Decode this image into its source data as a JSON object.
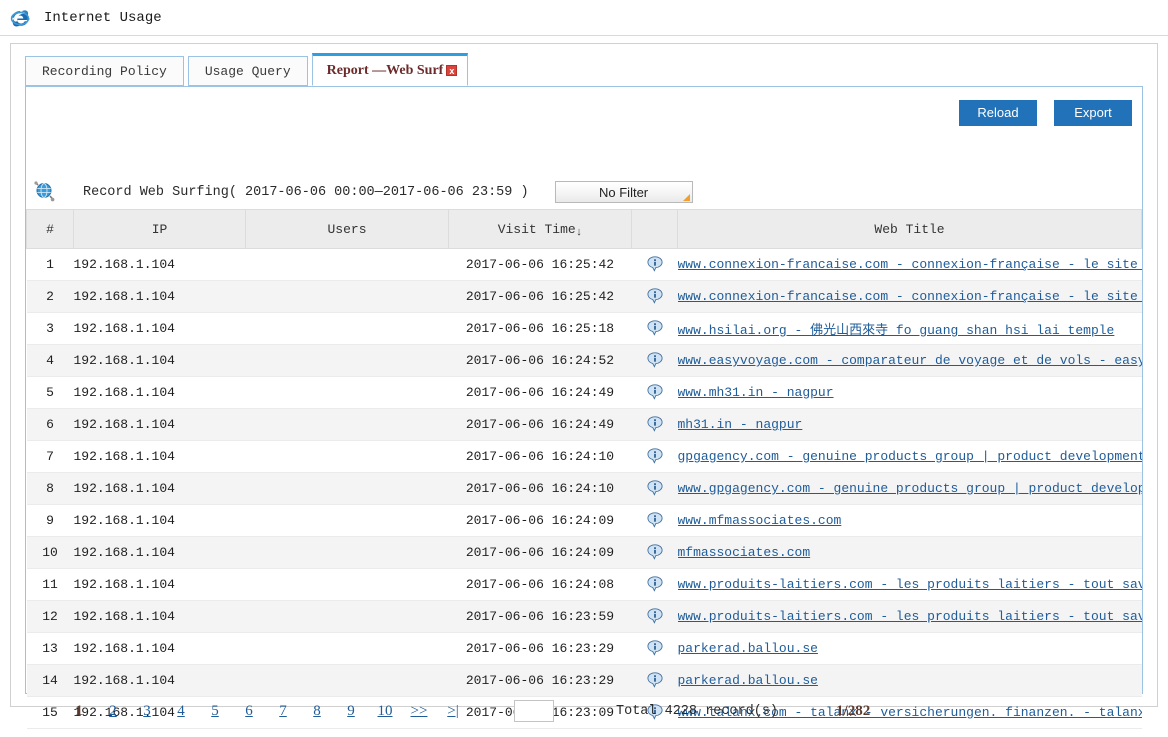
{
  "window": {
    "title": "Internet Usage",
    "browser_icon": "internet-explorer-icon"
  },
  "tabs": [
    {
      "label": "Recording Policy",
      "active": false
    },
    {
      "label": "Usage Query",
      "active": false
    },
    {
      "label": "Report —Web Surf",
      "active": true,
      "close_label": "x"
    }
  ],
  "toolbar": {
    "reload_label": "Reload",
    "export_label": "Export"
  },
  "record_header": {
    "icon": "globe-icon",
    "label": "Record Web Surfing( 2017-06-06 00:00—2017-06-06 23:59 )",
    "filter_value": "No Filter"
  },
  "table": {
    "columns": [
      "#",
      "IP",
      "Users",
      "Visit Time",
      "",
      "Web Title"
    ],
    "sort_column": "Visit Time",
    "sort_direction": "desc",
    "sort_arrow": "↓",
    "info_icon": "info-bubble-icon",
    "rows": [
      {
        "num": "1",
        "ip": "192.168.1.104",
        "user": "",
        "time": "2017-06-06 16:25:42",
        "title": "www.connexion-francaise.com  -   connexion-française - le site pra",
        "truncated": true
      },
      {
        "num": "2",
        "ip": "192.168.1.104",
        "user": "",
        "time": "2017-06-06 16:25:42",
        "title": "www.connexion-francaise.com  -   connexion-française - le site pra",
        "truncated": true
      },
      {
        "num": "3",
        "ip": "192.168.1.104",
        "user": "",
        "time": "2017-06-06 16:25:18",
        "title": "www.hsilai.org  -   佛光山西來寺 fo guang shan hsi lai temple",
        "truncated": false
      },
      {
        "num": "4",
        "ip": "192.168.1.104",
        "user": "",
        "time": "2017-06-06 16:24:52",
        "title": "www.easyvoyage.com  -   comparateur de voyage et de vols - easyvoy",
        "truncated": true
      },
      {
        "num": "5",
        "ip": "192.168.1.104",
        "user": "",
        "time": "2017-06-06 16:24:49",
        "title": "www.mh31.in  -   nagpur",
        "truncated": false
      },
      {
        "num": "6",
        "ip": "192.168.1.104",
        "user": "",
        "time": "2017-06-06 16:24:49",
        "title": "mh31.in  -   nagpur",
        "truncated": false
      },
      {
        "num": "7",
        "ip": "192.168.1.104",
        "user": "",
        "time": "2017-06-06 16:24:10",
        "title": "gpgagency.com  -   genuine products group | product development | ",
        "truncated": true
      },
      {
        "num": "8",
        "ip": "192.168.1.104",
        "user": "",
        "time": "2017-06-06 16:24:10",
        "title": "www.gpgagency.com  -   genuine products group | product developmen",
        "truncated": true
      },
      {
        "num": "9",
        "ip": "192.168.1.104",
        "user": "",
        "time": "2017-06-06 16:24:09",
        "title": "www.mfmassociates.com",
        "truncated": false
      },
      {
        "num": "10",
        "ip": "192.168.1.104",
        "user": "",
        "time": "2017-06-06 16:24:09",
        "title": "mfmassociates.com",
        "truncated": false
      },
      {
        "num": "11",
        "ip": "192.168.1.104",
        "user": "",
        "time": "2017-06-06 16:24:08",
        "title": "www.produits-laitiers.com  -   les produits laitiers - tout savoir",
        "truncated": true
      },
      {
        "num": "12",
        "ip": "192.168.1.104",
        "user": "",
        "time": "2017-06-06 16:23:59",
        "title": "www.produits-laitiers.com  -   les produits laitiers - tout savoir",
        "truncated": true
      },
      {
        "num": "13",
        "ip": "192.168.1.104",
        "user": "",
        "time": "2017-06-06 16:23:29",
        "title": "parkerad.ballou.se",
        "truncated": false
      },
      {
        "num": "14",
        "ip": "192.168.1.104",
        "user": "",
        "time": "2017-06-06 16:23:29",
        "title": "parkerad.ballou.se",
        "truncated": false
      },
      {
        "num": "15",
        "ip": "192.168.1.104",
        "user": "",
        "time": "2017-06-06 16:23:09",
        "title": "www.talanx.com  -   talanx - versicherungen. finanzen. - talanx",
        "truncated": false
      }
    ]
  },
  "pagination": {
    "pages": [
      "1",
      "2",
      "3",
      "4",
      "5",
      "6",
      "7",
      "8",
      "9",
      "10"
    ],
    "current_page": "1",
    "next_label": ">>",
    "last_label": ">|",
    "goto_value": "",
    "total_text": "Total  4228  record(s)",
    "page_indicator": "1/282"
  },
  "colors": {
    "accent_blue": "#2272b9",
    "tab_active_top": "#2f9ee0",
    "link": "#1f5c99",
    "tab_active_text": "#6b2b2b",
    "header_bg": "#ececec",
    "alt_row": "#f4f4f4"
  }
}
